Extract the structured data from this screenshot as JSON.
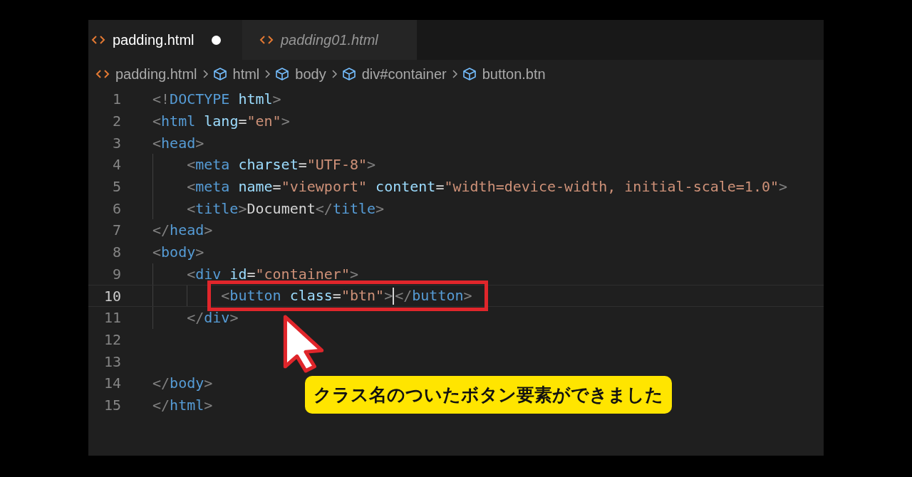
{
  "tabs": [
    {
      "label": "padding.html",
      "selected": true,
      "modified": true,
      "preview": false
    },
    {
      "label": "padding01.html",
      "selected": false,
      "modified": false,
      "preview": true
    }
  ],
  "breadcrumb": [
    {
      "kind": "file",
      "label": "padding.html"
    },
    {
      "kind": "element",
      "label": "html"
    },
    {
      "kind": "element",
      "label": "body"
    },
    {
      "kind": "element",
      "label": "div#container"
    },
    {
      "kind": "element",
      "label": "button.btn"
    }
  ],
  "lines": [
    {
      "number": "1",
      "current": false,
      "framed": false,
      "tokens": [
        {
          "kind": "punct",
          "text": "<!"
        },
        {
          "kind": "tag",
          "text": "DOCTYPE"
        },
        {
          "kind": "attr",
          "text": " html"
        },
        {
          "kind": "punct",
          "text": ">"
        }
      ]
    },
    {
      "number": "2",
      "current": false,
      "framed": false,
      "tokens": [
        {
          "kind": "punct",
          "text": "<"
        },
        {
          "kind": "tag",
          "text": "html"
        },
        {
          "kind": "attr",
          "text": " lang"
        },
        {
          "kind": "text",
          "text": "="
        },
        {
          "kind": "string",
          "text": "\"en\""
        },
        {
          "kind": "punct",
          "text": ">"
        }
      ]
    },
    {
      "number": "3",
      "current": false,
      "framed": false,
      "tokens": [
        {
          "kind": "punct",
          "text": "<"
        },
        {
          "kind": "tag",
          "text": "head"
        },
        {
          "kind": "punct",
          "text": ">"
        }
      ]
    },
    {
      "number": "4",
      "current": false,
      "framed": false,
      "tokens": [
        {
          "kind": "punct",
          "text": "    <"
        },
        {
          "kind": "tag",
          "text": "meta"
        },
        {
          "kind": "attr",
          "text": " charset"
        },
        {
          "kind": "text",
          "text": "="
        },
        {
          "kind": "string",
          "text": "\"UTF-8\""
        },
        {
          "kind": "punct",
          "text": ">"
        }
      ]
    },
    {
      "number": "5",
      "current": false,
      "framed": false,
      "tokens": [
        {
          "kind": "punct",
          "text": "    <"
        },
        {
          "kind": "tag",
          "text": "meta"
        },
        {
          "kind": "attr",
          "text": " name"
        },
        {
          "kind": "text",
          "text": "="
        },
        {
          "kind": "string",
          "text": "\"viewport\""
        },
        {
          "kind": "attr",
          "text": " content"
        },
        {
          "kind": "text",
          "text": "="
        },
        {
          "kind": "string",
          "text": "\"width=device-width, initial-scale=1.0\""
        },
        {
          "kind": "punct",
          "text": ">"
        }
      ]
    },
    {
      "number": "6",
      "current": false,
      "framed": false,
      "tokens": [
        {
          "kind": "punct",
          "text": "    <"
        },
        {
          "kind": "tag",
          "text": "title"
        },
        {
          "kind": "punct",
          "text": ">"
        },
        {
          "kind": "text",
          "text": "Document"
        },
        {
          "kind": "punct",
          "text": "</"
        },
        {
          "kind": "tag",
          "text": "title"
        },
        {
          "kind": "punct",
          "text": ">"
        }
      ]
    },
    {
      "number": "7",
      "current": false,
      "framed": false,
      "tokens": [
        {
          "kind": "punct",
          "text": "</"
        },
        {
          "kind": "tag",
          "text": "head"
        },
        {
          "kind": "punct",
          "text": ">"
        }
      ]
    },
    {
      "number": "8",
      "current": false,
      "framed": false,
      "tokens": [
        {
          "kind": "punct",
          "text": "<"
        },
        {
          "kind": "tag",
          "text": "body"
        },
        {
          "kind": "punct",
          "text": ">"
        }
      ]
    },
    {
      "number": "9",
      "current": false,
      "framed": false,
      "tokens": [
        {
          "kind": "punct",
          "text": "    <"
        },
        {
          "kind": "tag",
          "text": "div"
        },
        {
          "kind": "attr",
          "text": " id"
        },
        {
          "kind": "text",
          "text": "="
        },
        {
          "kind": "string",
          "text": "\"container\""
        },
        {
          "kind": "punct",
          "text": ">"
        }
      ]
    },
    {
      "number": "10",
      "current": true,
      "framed": true,
      "tokens": [
        {
          "kind": "punct",
          "text": "        <"
        },
        {
          "kind": "tag",
          "text": "button"
        },
        {
          "kind": "attr",
          "text": " class"
        },
        {
          "kind": "text",
          "text": "="
        },
        {
          "kind": "string",
          "text": "\"btn\""
        },
        {
          "kind": "punct",
          "text": ">"
        },
        {
          "kind": "punct",
          "text": "</",
          "cursor": true
        },
        {
          "kind": "tag",
          "text": "button"
        },
        {
          "kind": "punct",
          "text": ">"
        }
      ]
    },
    {
      "number": "11",
      "current": false,
      "framed": false,
      "tokens": [
        {
          "kind": "punct",
          "text": "    </"
        },
        {
          "kind": "tag",
          "text": "div"
        },
        {
          "kind": "punct",
          "text": ">"
        }
      ]
    },
    {
      "number": "12",
      "current": false,
      "framed": false
    },
    {
      "number": "13",
      "current": false,
      "framed": false
    },
    {
      "number": "14",
      "current": false,
      "framed": false,
      "tokens": [
        {
          "kind": "punct",
          "text": "</"
        },
        {
          "kind": "tag",
          "text": "body"
        },
        {
          "kind": "punct",
          "text": ">"
        }
      ]
    },
    {
      "number": "15",
      "current": false,
      "framed": false,
      "tokens": [
        {
          "kind": "punct",
          "text": "</"
        },
        {
          "kind": "tag",
          "text": "html"
        },
        {
          "kind": "punct",
          "text": ">"
        }
      ]
    }
  ],
  "callout": {
    "text": "クラス名のついたボタン要素ができました"
  }
}
